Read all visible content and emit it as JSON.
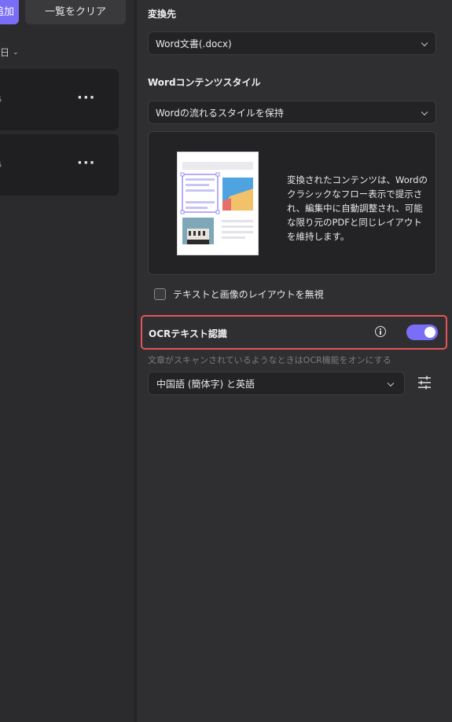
{
  "left": {
    "add_label": "追加",
    "clear_label": "一覧をクリア",
    "sort_label": "日",
    "files": [
      {
        "ext": "5",
        "more": "···"
      },
      {
        "ext": "5",
        "more": "···"
      }
    ]
  },
  "settings": {
    "output_label": "変換先",
    "output_value": "Word文書(.docx)",
    "style_label": "Wordコンテンツスタイル",
    "style_value": "Wordの流れるスタイルを保持",
    "preview_description": "変換されたコンテンツは、Wordのクラシックなフロー表示で提示され、編集中に自動調整され、可能な限り元のPDFと同じレイアウトを維持します。",
    "ignore_layout_label": "テキストと画像のレイアウトを無視",
    "ignore_layout_checked": false,
    "ocr_label": "OCRテキスト認識",
    "ocr_enabled": true,
    "ocr_hint": "文章がスキャンされているようなときはOCR機能をオンにする",
    "ocr_language": "中国語 (簡体字) と英語"
  },
  "colors": {
    "accent": "#7b6ef6",
    "highlight_border": "#e25559",
    "background": "#2f2f31"
  }
}
